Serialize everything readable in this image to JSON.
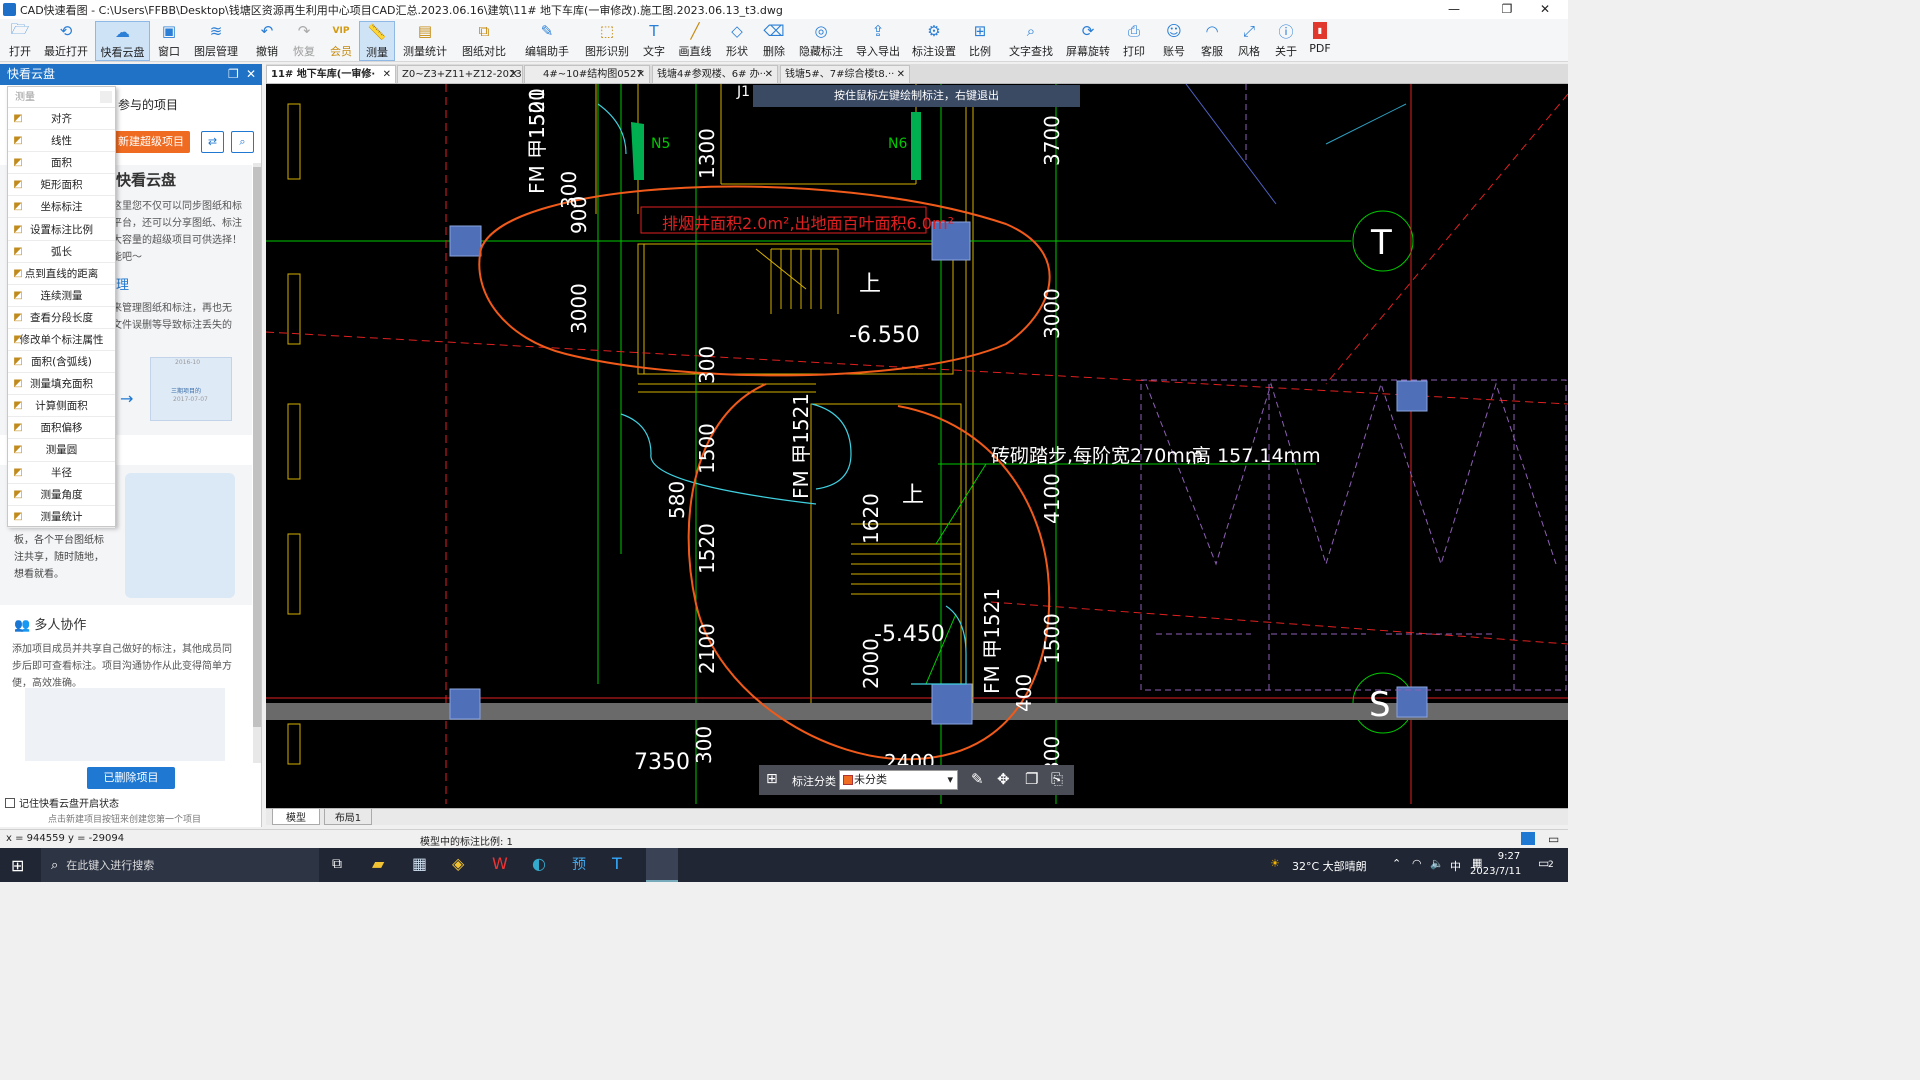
{
  "window": {
    "title": "CAD快速看图 - C:\\Users\\FFBB\\Desktop\\钱塘区资源再生利用中心项目CAD汇总.2023.06.16\\建筑\\11# 地下车库(一审修改).施工图.2023.06.13_t3.dwg",
    "min": "—",
    "max": "❐",
    "close": "✕"
  },
  "toolbar": [
    {
      "label": "打开",
      "icon": "folder-icon"
    },
    {
      "label": "最近打开",
      "icon": "history-icon"
    },
    {
      "label": "快看云盘",
      "icon": "cloud-icon"
    },
    {
      "label": "窗口",
      "icon": "window-icon"
    },
    {
      "label": "图层管理",
      "icon": "layers-icon"
    },
    {
      "label": "撤销",
      "icon": "undo-icon"
    },
    {
      "label": "恢复",
      "icon": "redo-icon"
    },
    {
      "label": "会员",
      "icon": "vip-icon",
      "badge": "VIP"
    },
    {
      "label": "测量",
      "icon": "ruler-icon"
    },
    {
      "label": "测量统计",
      "icon": "measure-stats-icon"
    },
    {
      "label": "图纸对比",
      "icon": "compare-icon"
    },
    {
      "label": "编辑助手",
      "icon": "edit-assistant-icon"
    },
    {
      "label": "图形识别",
      "icon": "shape-recognize-icon"
    },
    {
      "label": "文字",
      "icon": "text-icon"
    },
    {
      "label": "画直线",
      "icon": "line-icon"
    },
    {
      "label": "形状",
      "icon": "shape-icon"
    },
    {
      "label": "删除",
      "icon": "eraser-icon"
    },
    {
      "label": "隐藏标注",
      "icon": "hide-annotation-icon"
    },
    {
      "label": "导入导出",
      "icon": "import-export-icon"
    },
    {
      "label": "标注设置",
      "icon": "annotation-settings-icon"
    },
    {
      "label": "比例",
      "icon": "scale-icon"
    },
    {
      "label": "文字查找",
      "icon": "text-search-icon"
    },
    {
      "label": "屏幕旋转",
      "icon": "rotate-screen-icon"
    },
    {
      "label": "打印",
      "icon": "print-icon"
    },
    {
      "label": "账号",
      "icon": "account-icon"
    },
    {
      "label": "客服",
      "icon": "headset-icon"
    },
    {
      "label": "风格",
      "icon": "style-icon"
    },
    {
      "label": "关于",
      "icon": "info-icon"
    },
    {
      "label": "PDF",
      "icon": "pdf-icon"
    }
  ],
  "panel": {
    "title": "快看云盘",
    "projects_heading": "参与的项目",
    "new_project_button": "新建超级项目",
    "card1_title": "快看云盘",
    "card1_text": [
      "这里您不仅可以同步图纸和标",
      "平台，还可以分享图纸、标注",
      "大容量的超级项目可供选择！",
      "能吧～"
    ],
    "card2_title": "理",
    "card2_text": [
      "来管理图纸和标注，再也无",
      "文件误删等导致标注丢失的"
    ],
    "card3_text": [
      "板，各个平台图纸标",
      "注共享，随时随地，",
      "想看就看。"
    ],
    "collab_title": "多人协作",
    "collab_text": [
      "添加项目成员并共享自己做好的标注，其他成员同",
      "步后即可查看标注。项目沟通协作从此变得简单方",
      "便，高效准确。"
    ],
    "deleted_button": "已删除项目",
    "remember_label": "记住快看云盘开启状态",
    "bottom_hint": "点击新建项目按钮来创建您第一个项目",
    "illus_dates": [
      "2016-10",
      "2017-07-07"
    ],
    "illus_label": "三期项目的"
  },
  "measure_menu": {
    "header": "测量",
    "items": [
      "对齐",
      "线性",
      "面积",
      "矩形面积",
      "坐标标注",
      "设置标注比例",
      "弧长",
      "点到直线的距离",
      "连续测量",
      "查看分段长度",
      "修改单个标注属性",
      "面积(含弧线)",
      "测量填充面积",
      "计算侧面积",
      "面积偏移",
      "测量圆",
      "半径",
      "测量角度",
      "测量统计"
    ]
  },
  "tabs": [
    {
      "label": "11# 地下车库(一审修·",
      "active": true
    },
    {
      "label": "Z0~Z3+Z11+Z12-20230··",
      "active": false
    },
    {
      "label": "4#~10#结构图0527",
      "active": false
    },
    {
      "label": "钱塘4#参观楼、6# 办··",
      "active": false
    },
    {
      "label": "钱塘5#、7#综合楼t8.··",
      "active": false
    }
  ],
  "drawing": {
    "hint": "按住鼠标左键绘制标注，右键退出",
    "note_red": "排烟井面积2.0m²,出地面百叶面积6.0m²",
    "stair_note": "砖砌踏步,每阶宽270mm",
    "stair_height": ",高 157.14mm",
    "dims": [
      "1500",
      "900",
      "3000",
      "1300",
      "300",
      "300",
      "1500",
      "580",
      "1520",
      "2100",
      "1620",
      "2000",
      "3700",
      "3000",
      "4100",
      "1500",
      "400",
      "7350",
      "300",
      "2400",
      "300"
    ],
    "levels": [
      "-6.550",
      "-5.450"
    ],
    "up": "上",
    "door_label": "FM 甲1521",
    "n_labels": [
      "N5",
      "N6"
    ],
    "axis_labels": [
      "T",
      "S"
    ],
    "partial": "J1"
  },
  "anno_bar": {
    "label": "标注分类",
    "selected": "未分类"
  },
  "layout_tabs": [
    "模型",
    "布局1"
  ],
  "status": {
    "coords": "x = 944559  y = -29094",
    "scale": "模型中的标注比例: 1"
  },
  "taskbar": {
    "search_placeholder": "在此键入进行搜索",
    "weather": "32°C 大部晴朗",
    "ime": "中",
    "time": "9:27",
    "date": "2023/7/11",
    "notifications": "2"
  }
}
